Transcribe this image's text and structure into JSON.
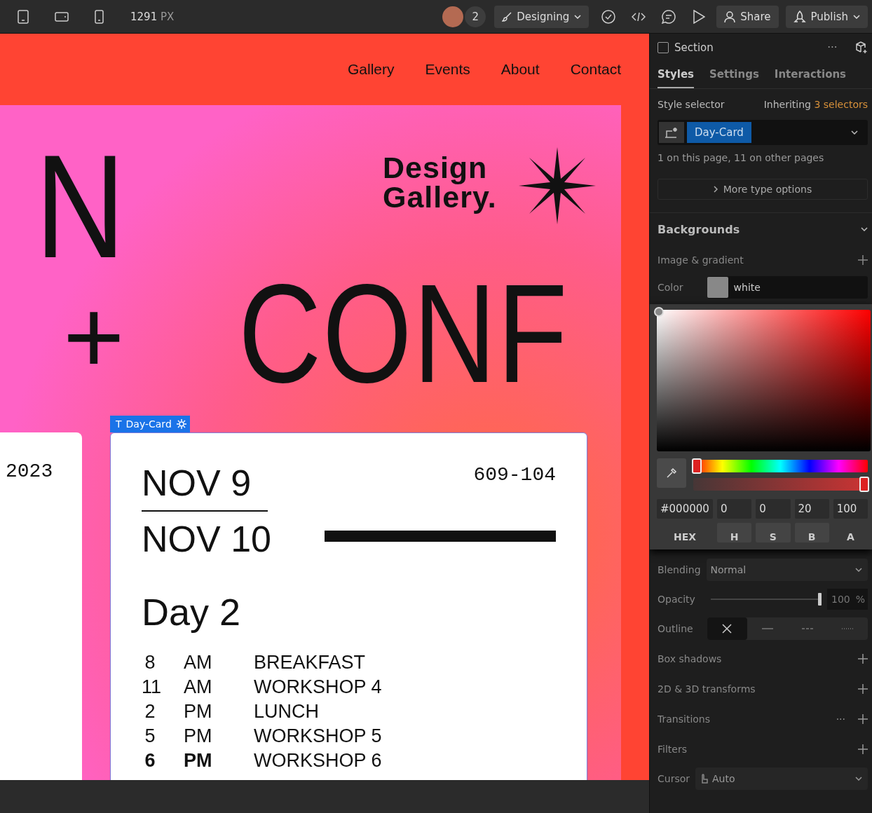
{
  "toolbar": {
    "devices": [
      {
        "kind": "tablet",
        "selected": false
      },
      {
        "kind": "landscape",
        "selected": false
      },
      {
        "kind": "phone",
        "selected": false
      }
    ],
    "width_value": "1291",
    "width_unit": "PX",
    "collaborator_count": "2",
    "mode": "Designing",
    "share": "Share",
    "publish": "Publish"
  },
  "site": {
    "nav": [
      "Gallery",
      "Events",
      "About",
      "Contact"
    ],
    "logo": "Design Gallery.",
    "hero": [
      "N",
      "+",
      "CONF"
    ],
    "side_card_text": "2023",
    "selection_label": "Day-Card",
    "selection_type_icon": "T",
    "card": {
      "date_start": "NOV 9",
      "date_end": "NOV 10",
      "code": "609-104",
      "day": "Day 2",
      "schedule": [
        {
          "hour": "8",
          "period": "AM",
          "event": "BREAKFAST",
          "emphasized": false
        },
        {
          "hour": "11",
          "period": "AM",
          "event": "WORKSHOP 4",
          "emphasized": false
        },
        {
          "hour": "2",
          "period": "PM",
          "event": "LUNCH",
          "emphasized": false
        },
        {
          "hour": "5",
          "period": "PM",
          "event": "WORKSHOP 5",
          "emphasized": false
        },
        {
          "hour": "6",
          "period": "PM",
          "event": "WORKSHOP 6",
          "emphasized": true
        }
      ]
    }
  },
  "panel": {
    "element": "Section",
    "more_icon": "···",
    "tabs": [
      {
        "label": "Styles",
        "selected": true
      },
      {
        "label": "Settings",
        "selected": false
      },
      {
        "label": "Interactions",
        "selected": false
      }
    ],
    "style_selector": "Style selector",
    "inheriting": "Inheriting",
    "inheriting_link": "3 selectors",
    "class_tag": "Day-Card",
    "usage": "1 on this page, 11 on other pages",
    "more_options": "More type options",
    "backgrounds": {
      "title": "Backgrounds",
      "image_gradient": "Image & gradient",
      "color_label": "Color",
      "color_value": "white",
      "picker": {
        "hue": {
          "level": 0
        },
        "alpha": {
          "level": 1
        },
        "fields": [
          {
            "value": "#000000",
            "label": "HEX"
          },
          {
            "value": "0",
            "label": "H"
          },
          {
            "value": "0",
            "label": "S"
          },
          {
            "value": "20",
            "label": "B"
          },
          {
            "value": "100",
            "label": "A"
          }
        ]
      }
    },
    "blending": {
      "label": "Blending",
      "value": "Normal"
    },
    "opacity": {
      "label": "Opacity",
      "level": 1,
      "value": "100",
      "unit": "%"
    },
    "outline": {
      "label": "Outline",
      "options": [
        {
          "kind": "none",
          "selected": true
        },
        {
          "kind": "solid",
          "selected": false
        },
        {
          "kind": "dashed",
          "selected": false
        },
        {
          "kind": "dotted",
          "selected": false
        }
      ]
    },
    "sections": [
      {
        "label": "Box shadows"
      },
      {
        "label": "2D & 3D transforms"
      },
      {
        "label": "Transitions",
        "more_icon": "···"
      },
      {
        "label": "Filters"
      }
    ],
    "cursor": {
      "label": "Cursor",
      "value": "Auto"
    }
  }
}
